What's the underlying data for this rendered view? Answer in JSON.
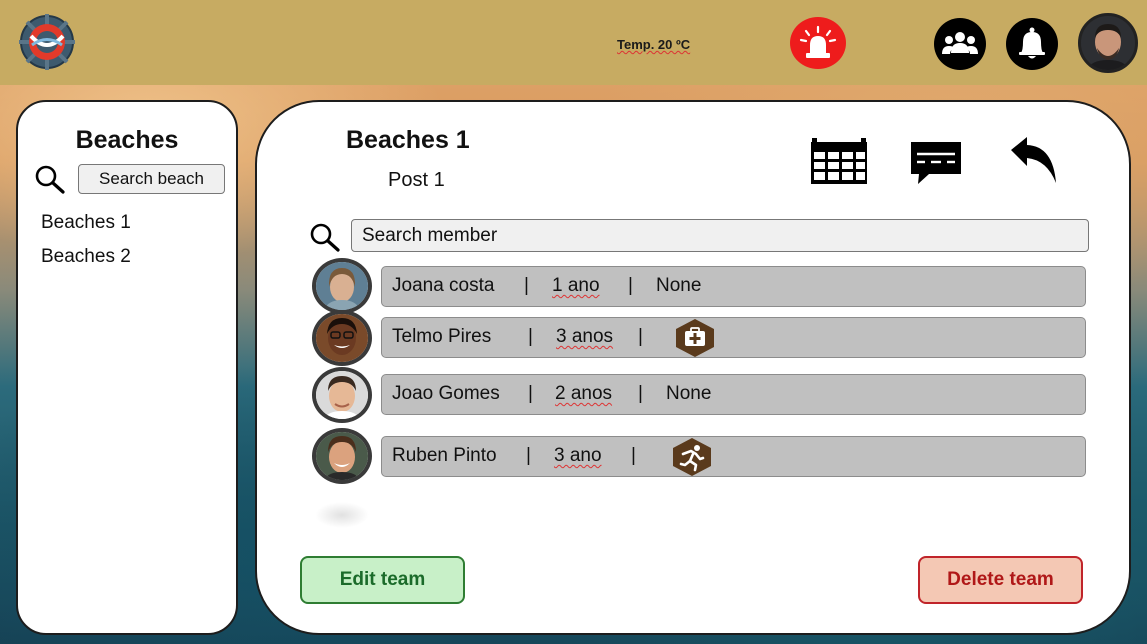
{
  "header": {
    "temperature": "Temp. 20 ºC",
    "icons": [
      "lifebuoy-logo-icon",
      "alarm-siren-icon",
      "team-group-icon",
      "bell-icon",
      "user-avatar"
    ],
    "colors": {
      "bar": "#c7ab62",
      "alarm": "#ee1c1c"
    }
  },
  "sidebar": {
    "title": "Beaches",
    "search_placeholder": "Search beach",
    "items": [
      {
        "label": "Beaches 1"
      },
      {
        "label": "Beaches 2"
      }
    ]
  },
  "main": {
    "title": "Beaches 1",
    "subtitle": "Post 1",
    "toolbar_icons": [
      "calendar-icon",
      "message-icon",
      "back-arrow-icon"
    ],
    "search_placeholder": "Search member",
    "members": [
      {
        "name": "Joana costa",
        "years": "1 ano",
        "role": "None",
        "role_icon": ""
      },
      {
        "name": "Telmo Pires",
        "years": "3 anos",
        "role": "",
        "role_icon": "first-aid-icon"
      },
      {
        "name": "Joao Gomes",
        "years": "2 anos",
        "role": "None",
        "role_icon": ""
      },
      {
        "name": "Ruben Pinto",
        "years": "3 ano",
        "role": "",
        "role_icon": "runner-icon"
      }
    ],
    "separator": "|",
    "edit_button": "Edit team",
    "delete_button": "Delete team"
  }
}
